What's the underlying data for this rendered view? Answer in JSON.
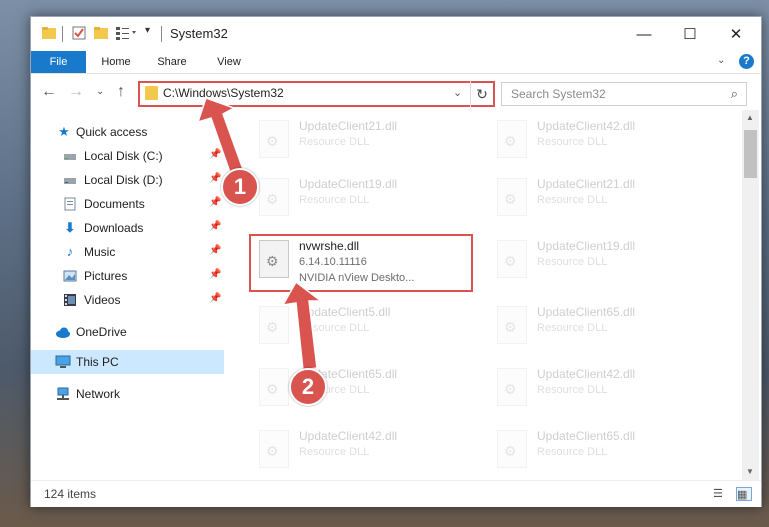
{
  "window": {
    "title": "System32",
    "minimize": "—",
    "maximize": "☐",
    "close": "✕"
  },
  "ribbon": {
    "tabs": [
      "File",
      "Home",
      "Share",
      "View"
    ],
    "help": "?"
  },
  "nav": {
    "address": "C:\\Windows\\System32",
    "search_placeholder": "Search System32"
  },
  "sidebar": {
    "items": [
      {
        "label": "Quick access",
        "icon": "star-icon"
      },
      {
        "label": "Local Disk (C:)",
        "icon": "drive-icon"
      },
      {
        "label": "Local Disk (D:)",
        "icon": "drive-icon"
      },
      {
        "label": "Documents",
        "icon": "documents-icon"
      },
      {
        "label": "Downloads",
        "icon": "downloads-icon"
      },
      {
        "label": "Music",
        "icon": "music-icon"
      },
      {
        "label": "Pictures",
        "icon": "pictures-icon"
      },
      {
        "label": "Videos",
        "icon": "videos-icon"
      },
      {
        "label": "OneDrive",
        "icon": "onedrive-icon"
      },
      {
        "label": "This PC",
        "icon": "computer-icon"
      },
      {
        "label": "Network",
        "icon": "network-icon"
      }
    ]
  },
  "files": {
    "left": [
      {
        "name": "UpdateClient21.dll",
        "sub": "Resource DLL"
      },
      {
        "name": "UpdateClient19.dll",
        "sub": "Resource DLL"
      },
      {
        "name": "nvwrshe.dll",
        "sub": "6.14.10.11116",
        "sub2": "NVIDIA nView Deskto..."
      },
      {
        "name": "UpdateClient5.dll",
        "sub": "Resource DLL"
      },
      {
        "name": "UpdateClient65.dll",
        "sub": "Resource DLL"
      },
      {
        "name": "UpdateClient42.dll",
        "sub": "Resource DLL"
      }
    ],
    "right": [
      {
        "name": "UpdateClient42.dll",
        "sub": "Resource DLL"
      },
      {
        "name": "UpdateClient21.dll",
        "sub": "Resource DLL"
      },
      {
        "name": "UpdateClient19.dll",
        "sub": "Resource DLL"
      },
      {
        "name": "UpdateClient65.dll",
        "sub": "Resource DLL"
      },
      {
        "name": "UpdateClient42.dll",
        "sub": "Resource DLL"
      },
      {
        "name": "UpdateClient65.dll",
        "sub": "Resource DLL"
      }
    ]
  },
  "status": {
    "count": "124 items"
  },
  "annotations": {
    "step1": "1",
    "step2": "2"
  },
  "colors": {
    "accent": "#1979ca",
    "highlight": "#d9534f",
    "selected": "#cce8ff"
  }
}
